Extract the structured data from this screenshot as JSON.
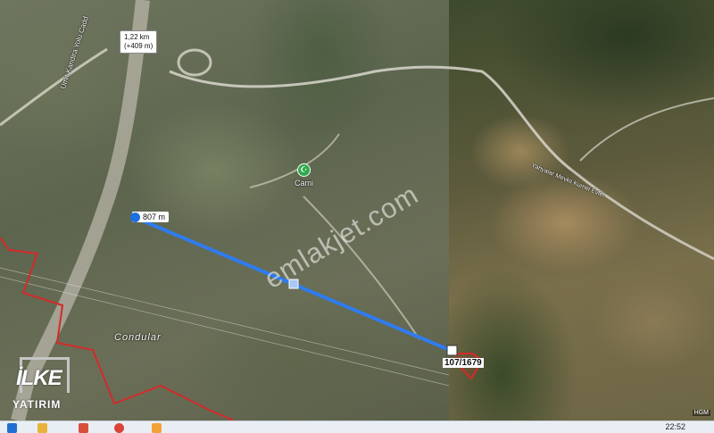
{
  "map": {
    "road_label": "Umit Kandira Yolu Cadd",
    "elevation_tooltip": {
      "line1": "1,22 km",
      "line2": "(+409 m)"
    },
    "measure": {
      "label": "807 m",
      "line_color": "#2f7cf0"
    },
    "poi": {
      "name": "Cami",
      "icon": "mosque-icon",
      "color": "#2ea84b"
    },
    "place_name": "Condular",
    "area_label": "Yahyalar Mevkii Kumel Evler",
    "parcel_label": "107/1679",
    "parcel_color": "#d42a2a",
    "boundary_color": "#d42a2a"
  },
  "watermark": "emlakjet.com",
  "logo": {
    "main": "İLKE",
    "sub": "YATIRIM"
  },
  "attribution": "HGM",
  "taskbar": {
    "time": "22:52",
    "apps": [
      {
        "icon": "windows-icon",
        "color": "#1e6fd0"
      },
      {
        "icon": "file-explorer-icon",
        "color": "#e8b33a"
      },
      {
        "icon": "paint-icon",
        "color": "#d84f3a"
      },
      {
        "icon": "chrome-icon",
        "color": "#db4437"
      },
      {
        "icon": "app-icon",
        "color": "#f3a23a"
      }
    ]
  }
}
